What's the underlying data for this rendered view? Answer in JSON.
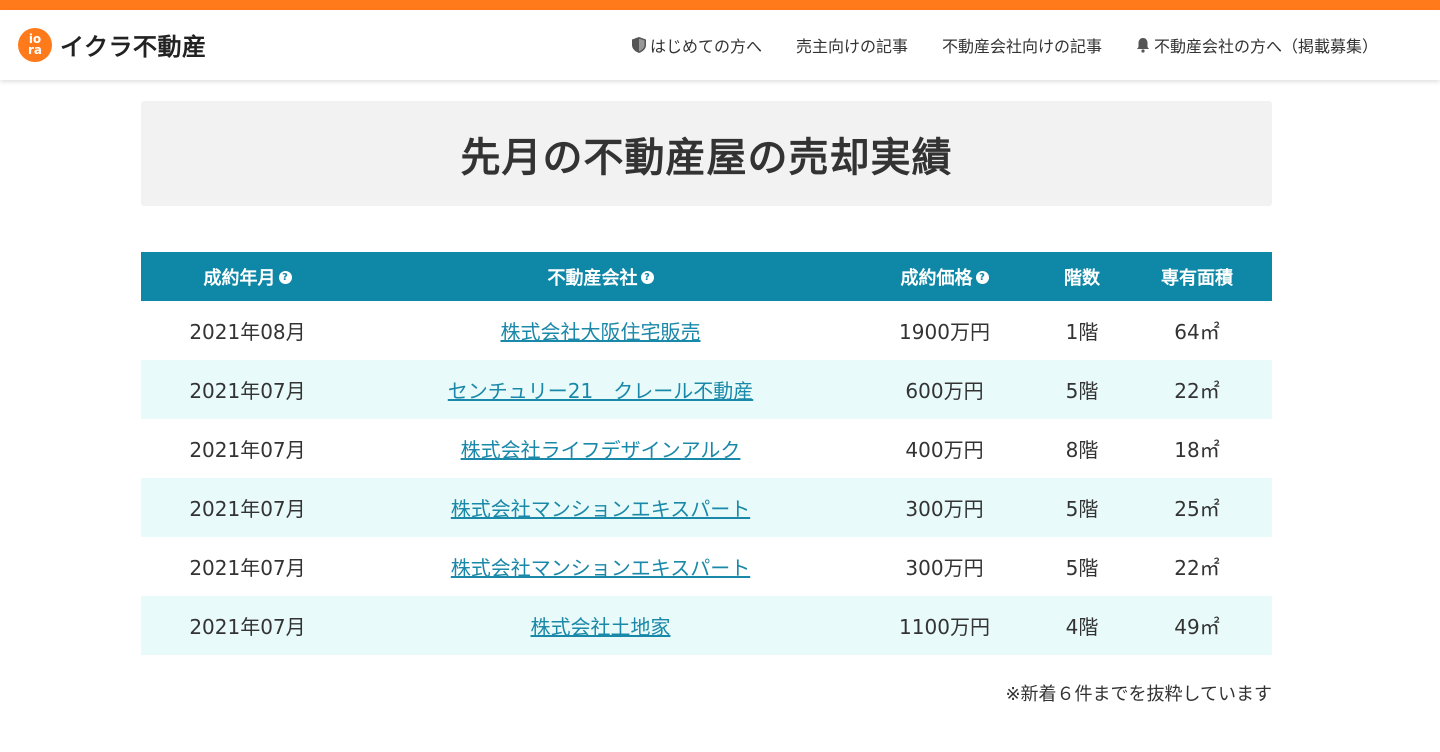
{
  "colors": {
    "accent": "#ff7a1a",
    "table_header": "#0f87a6",
    "link": "#1a88a8",
    "stripe_row": "#e8fbfa"
  },
  "header": {
    "logo_mark_top": "io",
    "logo_mark_bottom": "ra",
    "logo_text": "イクラ不動産",
    "nav": [
      {
        "label": "はじめての方へ",
        "icon": "shield-icon"
      },
      {
        "label": "売主向けの記事"
      },
      {
        "label": "不動産会社向けの記事"
      },
      {
        "label": "不動産会社の方へ（掲載募集）",
        "icon": "bell-icon"
      }
    ]
  },
  "main": {
    "title": "先月の不動産屋の売却実績",
    "footnote": "※新着６件までを抜粋しています"
  },
  "table": {
    "columns": [
      "成約年月",
      "不動産会社",
      "成約価格",
      "階数",
      "専有面積"
    ],
    "help_mark": "?",
    "rows": [
      [
        "2021年08月",
        "株式会社大阪住宅販売",
        "1900万円",
        "1階",
        "64㎡"
      ],
      [
        "2021年07月",
        "センチュリー21　クレール不動産",
        "600万円",
        "5階",
        "22㎡"
      ],
      [
        "2021年07月",
        "株式会社ライフデザインアルク",
        "400万円",
        "8階",
        "18㎡"
      ],
      [
        "2021年07月",
        "株式会社マンションエキスパート",
        "300万円",
        "5階",
        "25㎡"
      ],
      [
        "2021年07月",
        "株式会社マンションエキスパート",
        "300万円",
        "5階",
        "22㎡"
      ],
      [
        "2021年07月",
        "株式会社土地家",
        "1100万円",
        "4階",
        "49㎡"
      ]
    ]
  }
}
